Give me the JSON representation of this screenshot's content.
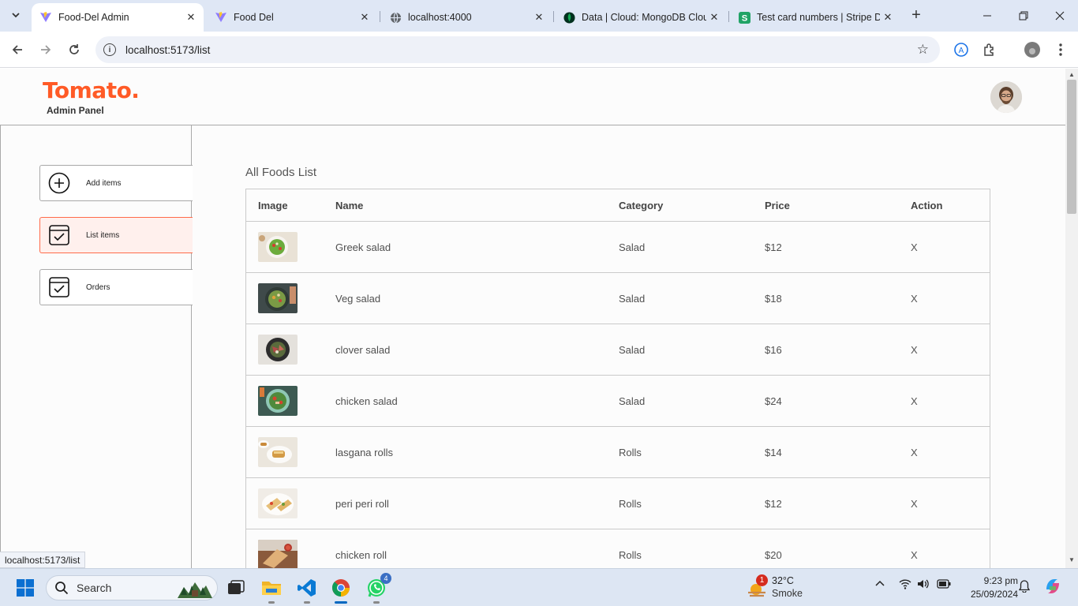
{
  "browser": {
    "tabs": [
      {
        "title": "Food-Del Admin",
        "active": true,
        "favicon": "vite-icon"
      },
      {
        "title": "Food Del",
        "active": false,
        "favicon": "vite-icon"
      },
      {
        "title": "localhost:4000",
        "active": false,
        "favicon": "globe-icon"
      },
      {
        "title": "Data | Cloud: MongoDB Clou",
        "active": false,
        "favicon": "mongodb-leaf-icon"
      },
      {
        "title": "Test card numbers | Stripe Do",
        "active": false,
        "favicon": "stripe-icon"
      }
    ],
    "url": "localhost:5173/list",
    "status_url": "localhost:5173/list"
  },
  "app": {
    "logo": "Tomato.",
    "logo_subtitle": "Admin Panel",
    "accent_color": "#ff5a26"
  },
  "sidebar": {
    "items": [
      {
        "label": "Add items",
        "icon": "add-circle-icon",
        "active": false
      },
      {
        "label": "List items",
        "icon": "checklist-icon",
        "active": true
      },
      {
        "label": "Orders",
        "icon": "orders-icon",
        "active": false
      }
    ]
  },
  "list": {
    "title": "All Foods List",
    "headers": {
      "image": "Image",
      "name": "Name",
      "category": "Category",
      "price": "Price",
      "action": "Action"
    },
    "rows": [
      {
        "name": "Greek salad",
        "category": "Salad",
        "price": "$12",
        "action": "X"
      },
      {
        "name": "Veg salad",
        "category": "Salad",
        "price": "$18",
        "action": "X"
      },
      {
        "name": "clover salad",
        "category": "Salad",
        "price": "$16",
        "action": "X"
      },
      {
        "name": "chicken salad",
        "category": "Salad",
        "price": "$24",
        "action": "X"
      },
      {
        "name": "lasgana rolls",
        "category": "Rolls",
        "price": "$14",
        "action": "X"
      },
      {
        "name": "peri peri roll",
        "category": "Rolls",
        "price": "$12",
        "action": "X"
      },
      {
        "name": "chicken roll",
        "category": "Rolls",
        "price": "$20",
        "action": "X"
      }
    ]
  },
  "taskbar": {
    "search_label": "Search",
    "whatsapp_badge": "4",
    "weather_badge": "1",
    "weather_temp": "32°C",
    "weather_condition": "Smoke",
    "time": "9:23 pm",
    "date": "25/09/2024"
  }
}
